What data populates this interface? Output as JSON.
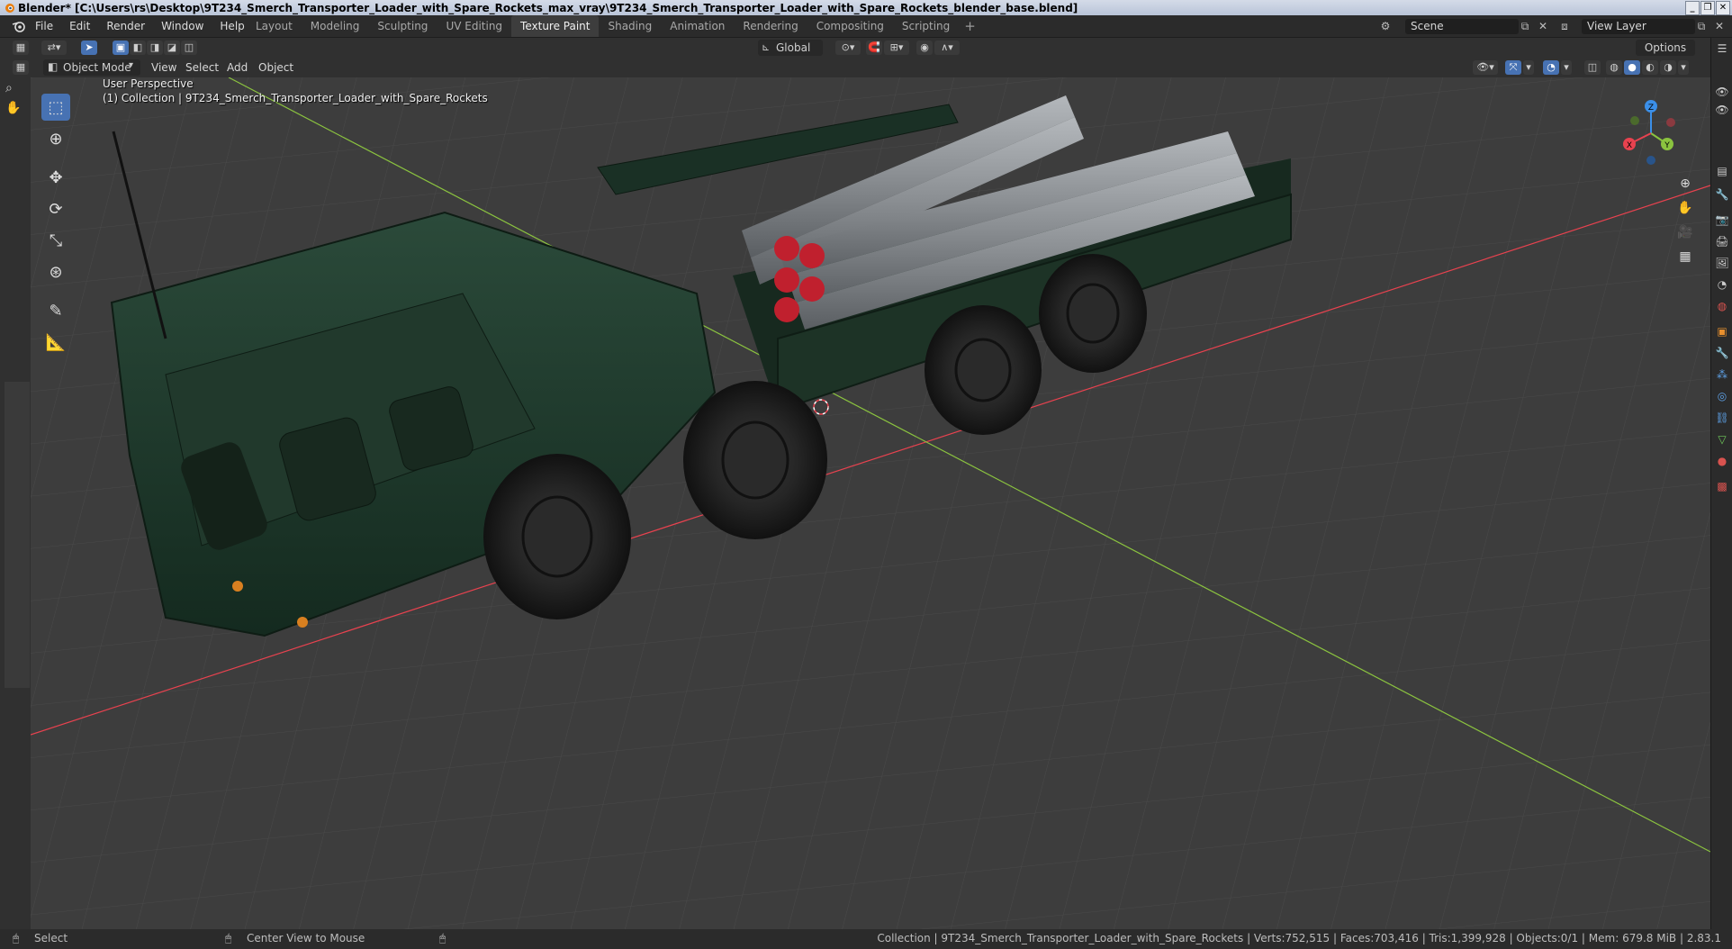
{
  "window": {
    "title": "Blender* [C:\\Users\\rs\\Desktop\\9T234_Smerch_Transporter_Loader_with_Spare_Rockets_max_vray\\9T234_Smerch_Transporter_Loader_with_Spare_Rockets_blender_base.blend]",
    "controls": [
      "_",
      "❐",
      "✕"
    ]
  },
  "menus": [
    "File",
    "Edit",
    "Render",
    "Window",
    "Help"
  ],
  "workspaces": [
    {
      "label": "Layout",
      "active": false
    },
    {
      "label": "Modeling",
      "active": false
    },
    {
      "label": "Sculpting",
      "active": false
    },
    {
      "label": "UV Editing",
      "active": false
    },
    {
      "label": "Texture Paint",
      "active": true
    },
    {
      "label": "Shading",
      "active": false
    },
    {
      "label": "Animation",
      "active": false
    },
    {
      "label": "Rendering",
      "active": false
    },
    {
      "label": "Compositing",
      "active": false
    },
    {
      "label": "Scripting",
      "active": false
    }
  ],
  "workspace_add": "+",
  "scene": {
    "label": "Scene",
    "view_layer": "View Layer"
  },
  "tool_header": {
    "transform_orientation": "Global",
    "options_label": "Options"
  },
  "view_header": {
    "mode": "Object Mode",
    "menus": [
      "View",
      "Select",
      "Add",
      "Object"
    ]
  },
  "viewport": {
    "perspective_label": "User Perspective",
    "collection_label": "(1) Collection | 9T234_Smerch_Transporter_Loader_with_Spare_Rockets",
    "gizmo_axes": {
      "z": "Z",
      "y": "Y",
      "x": "X"
    }
  },
  "tools": [
    {
      "name": "select-box-tool",
      "icon": "⬚",
      "active": true
    },
    {
      "name": "cursor-tool",
      "icon": "⊕",
      "active": false
    },
    {
      "name": "move-tool",
      "icon": "✥",
      "active": false
    },
    {
      "name": "rotate-tool",
      "icon": "⟳",
      "active": false
    },
    {
      "name": "scale-tool",
      "icon": "⤡",
      "active": false
    },
    {
      "name": "transform-tool",
      "icon": "⊛",
      "active": false
    },
    {
      "name": "annotate-tool",
      "icon": "✎",
      "active": false
    },
    {
      "name": "measure-tool",
      "icon": "📐",
      "active": false
    }
  ],
  "statusbar": {
    "left_action": "Select",
    "middle_action": "Center View to Mouse",
    "stats": "Collection | 9T234_Smerch_Transporter_Loader_with_Spare_Rockets | Verts:752,515 | Faces:703,416 | Tris:1,399,928 | Objects:0/1 | Mem: 679.8 MiB | 2.83.1"
  },
  "colors": {
    "accent": "#4772b3",
    "x_axis": "#e8424f",
    "y_axis": "#8bc33f",
    "z_axis": "#3b8fe8",
    "vehicle_green": "#1f3a2d"
  }
}
